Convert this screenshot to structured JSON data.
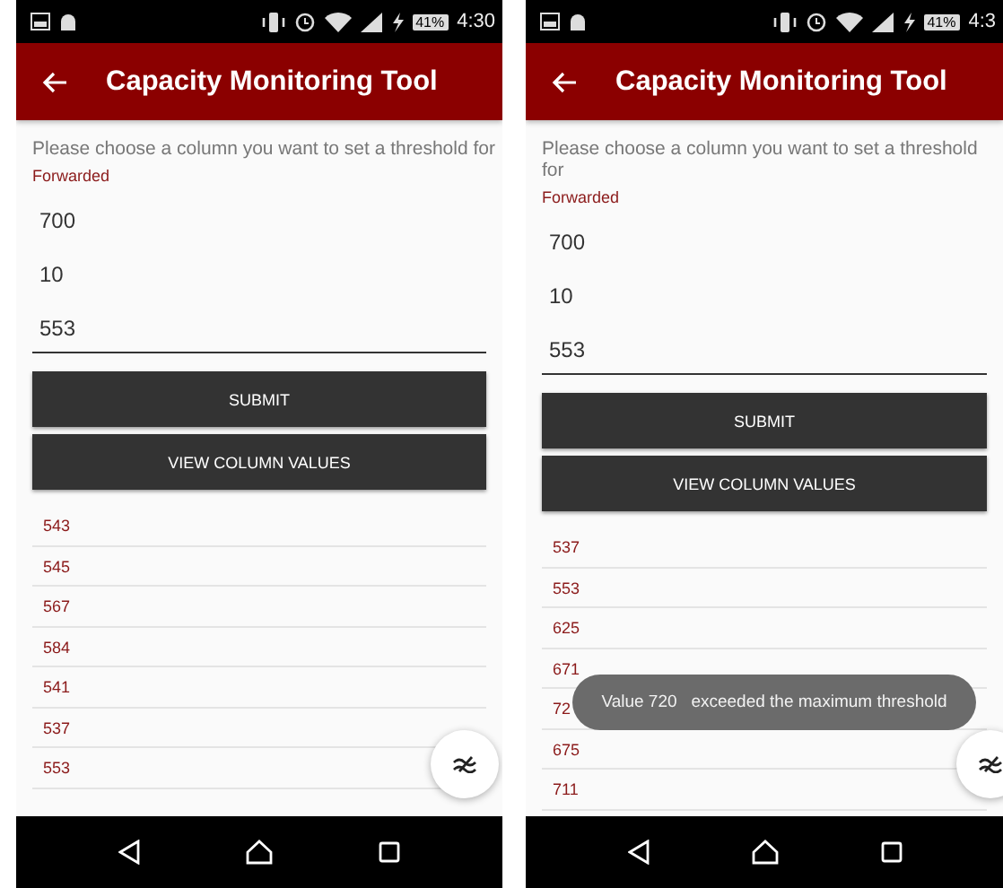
{
  "phones": [
    {
      "status_bar": {
        "battery": "41%",
        "time": "4:30"
      },
      "app_bar": {
        "title": "Capacity Monitoring Tool"
      },
      "prompt": "Please choose a column you want to set a threshold for",
      "column_label": "Forwarded",
      "fields": [
        {
          "value": "700",
          "focused": false
        },
        {
          "value": "10",
          "focused": false
        },
        {
          "value": "553",
          "focused": true
        }
      ],
      "buttons": [
        "SUBMIT",
        "VIEW COLUMN VALUES"
      ],
      "values": [
        "543",
        "545",
        "567",
        "584",
        "541",
        "537",
        "553"
      ]
    },
    {
      "status_bar": {
        "battery": "41%",
        "time": "4:3"
      },
      "app_bar": {
        "title": "Capacity Monitoring Tool"
      },
      "prompt": "Please choose a column you want to set a threshold for",
      "column_label": "Forwarded",
      "fields": [
        {
          "value": "700",
          "focused": false
        },
        {
          "value": "10",
          "focused": false
        },
        {
          "value": "553",
          "focused": true
        }
      ],
      "buttons": [
        "SUBMIT",
        "VIEW COLUMN VALUES"
      ],
      "values": [
        "537",
        "553",
        "625",
        "671",
        "72",
        "675",
        "711"
      ],
      "toast": "Value 720   exceeded the maximum threshold"
    }
  ]
}
